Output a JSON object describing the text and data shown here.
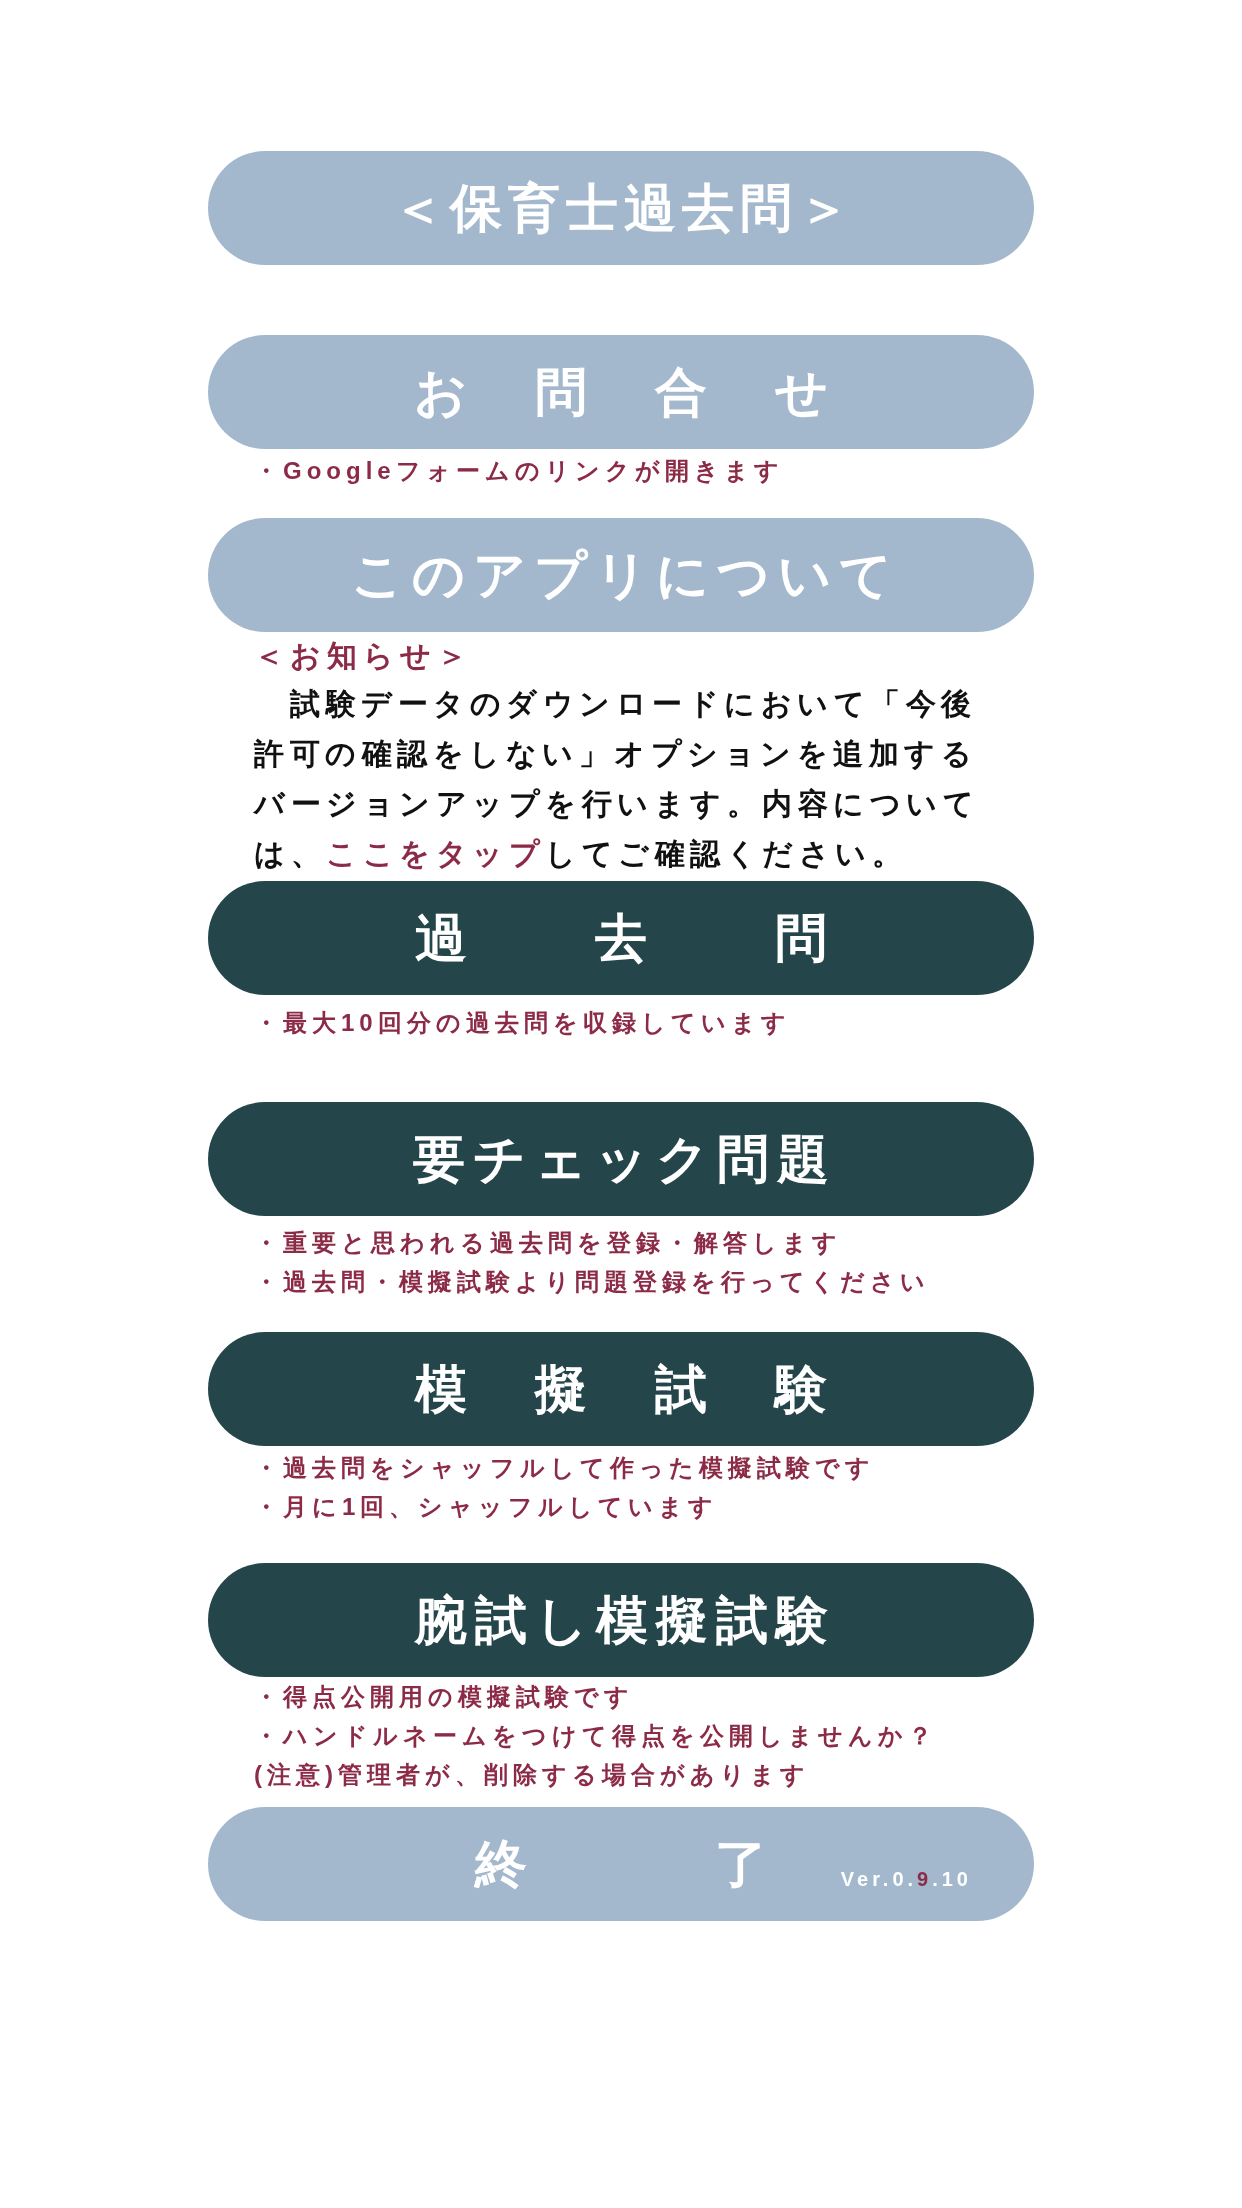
{
  "header": {
    "title": "＜保育士過去問＞"
  },
  "menu": [
    {
      "label": "お　問　合　せ",
      "color": "#a3b8cd",
      "notes": [
        "・Googleフォームのリンクが開きます"
      ]
    },
    {
      "label": "このアプリについて",
      "color": "#a3b8cd",
      "notice": {
        "heading": "＜お知らせ＞",
        "parts": [
          {
            "kind": "text",
            "text": "試験データのダウンロードにおいて「今後許可の確認をしない」オプションを追加するバージョンアップを行います。内容については、"
          },
          {
            "kind": "link",
            "text": "ここをタップ"
          },
          {
            "kind": "text",
            "text": "してご確認ください。"
          }
        ]
      }
    },
    {
      "label": "過　　去　　問",
      "color": "#24454a",
      "notes": [
        "・最大10回分の過去問を収録しています"
      ]
    },
    {
      "label": "要チェック問題",
      "color": "#24454a",
      "notes": [
        "・重要と思われる過去問を登録・解答します",
        "・過去問・模擬試験より問題登録を行ってください"
      ]
    },
    {
      "label": "模　擬　試　験",
      "color": "#24454a",
      "notes": [
        "・過去問をシャッフルして作った模擬試験です",
        "・月に1回、シャッフルしています"
      ]
    },
    {
      "label": "腕試し模擬試験",
      "color": "#24454a",
      "notes": [
        "・得点公開用の模擬試験です",
        "・ハンドルネームをつけて得点を公開しませんか？",
        "(注意)管理者が、削除する場合があります"
      ]
    },
    {
      "label": "終　　　了",
      "color": "#a3b8cd",
      "version": [
        {
          "text": "Ver.0.",
          "highlight": false
        },
        {
          "text": "9",
          "highlight": true
        },
        {
          "text": ".10",
          "highlight": false
        }
      ]
    }
  ]
}
